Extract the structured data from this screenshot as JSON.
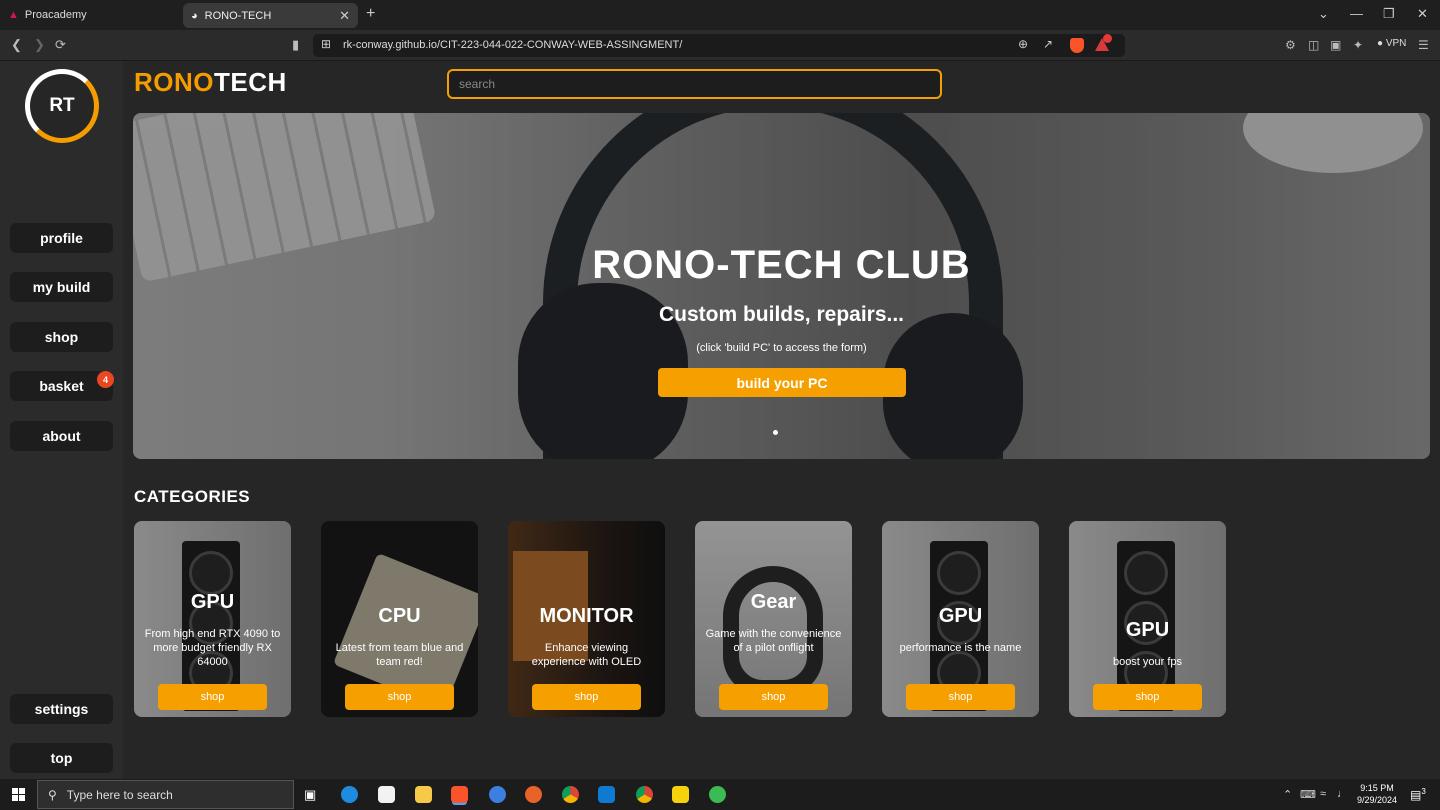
{
  "browser": {
    "tabs": [
      {
        "label": "Proacademy"
      },
      {
        "label": "RONO-TECH"
      }
    ],
    "url": "rk-conway.github.io/CIT-223-044-022-CONWAY-WEB-ASSINGMENT/",
    "vpn_label": "VPN",
    "bat_badge": "1"
  },
  "sidebar": {
    "logo_text": "RT",
    "items": [
      {
        "label": "profile"
      },
      {
        "label": "my build"
      },
      {
        "label": "shop"
      },
      {
        "label": "basket"
      },
      {
        "label": "about"
      }
    ],
    "basket_count": "4",
    "settings_label": "settings",
    "top_label": "top"
  },
  "header": {
    "brand_part1": "RONO",
    "brand_part2": "TECH",
    "search_placeholder": "search"
  },
  "hero": {
    "title": "RONO-TECH CLUB",
    "subtitle": "Custom builds, repairs...",
    "note": "(click 'build PC' to access the form)",
    "button": "build your PC"
  },
  "categories": {
    "title": "CATEGORIES",
    "items": [
      {
        "title": "GPU",
        "desc": "From high end RTX 4090 to more budget friendly RX 64000",
        "button": "shop"
      },
      {
        "title": "CPU",
        "desc": "Latest from team blue and team red!",
        "button": "shop"
      },
      {
        "title": "MONITOR",
        "desc": "Enhance viewing experience with OLED",
        "button": "shop"
      },
      {
        "title": "Gear",
        "desc": "Game with the convenience of a pilot onflight",
        "button": "shop"
      },
      {
        "title": "GPU",
        "desc": "performance is the name",
        "button": "shop"
      },
      {
        "title": "GPU",
        "desc": "boost your fps",
        "button": "shop"
      }
    ]
  },
  "taskbar": {
    "search_placeholder": "Type here to search",
    "time": "9:15 PM",
    "date": "9/29/2024",
    "notifications": "3"
  }
}
